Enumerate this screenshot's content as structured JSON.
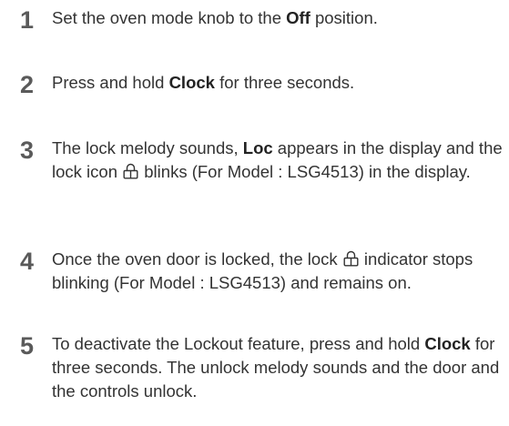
{
  "steps": [
    {
      "number": "1",
      "parts": [
        {
          "text": "Set the oven mode knob to the "
        },
        {
          "text": "Off",
          "bold": true
        },
        {
          "text": " position."
        }
      ]
    },
    {
      "number": "2",
      "parts": [
        {
          "text": "Press and hold "
        },
        {
          "text": "Clock",
          "bold": true
        },
        {
          "text": " for three seconds."
        }
      ]
    },
    {
      "number": "3",
      "parts": [
        {
          "text": "The lock melody sounds, "
        },
        {
          "text": "Loc",
          "bold": true
        },
        {
          "text": " appears in the display and the lock icon "
        },
        {
          "icon": "lock-icon"
        },
        {
          "text": " blinks (For Model : LSG4513) in the display."
        }
      ]
    },
    {
      "number": "4",
      "parts": [
        {
          "text": "Once the oven door is locked, the lock "
        },
        {
          "icon": "lock-icon"
        },
        {
          "text": " indicator stops blinking (For Model : LSG4513) and remains on."
        }
      ]
    },
    {
      "number": "5",
      "parts": [
        {
          "text": "To deactivate the Lockout feature, press and hold "
        },
        {
          "text": "Clock",
          "bold": true
        },
        {
          "text": " for three seconds. The unlock melody sounds and the door and the controls unlock."
        }
      ]
    }
  ]
}
